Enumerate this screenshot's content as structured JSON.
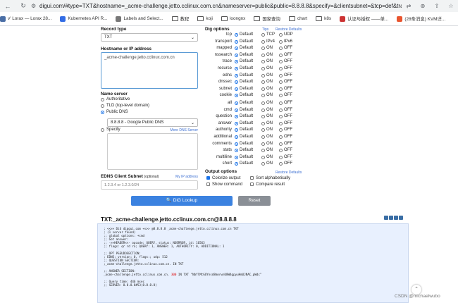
{
  "browser": {
    "url": "digui.com/#type=TXT&hostname=_acme-challenge.jetto.cclinux.com.cn&nameserver=public&public=8.8.8.8&specify=&clientsubnet=&tcp=def&transpor...",
    "bookmarks": [
      {
        "label": "v' Lorax — Lorax 28...",
        "icon": "lorax-icon",
        "color": "#4a6ea5"
      },
      {
        "label": "Kubernetes API R...",
        "icon": "kubernetes-icon",
        "color": "#326ce5"
      },
      {
        "label": "Labels and Select...",
        "icon": "globe-icon",
        "color": "#777"
      },
      {
        "label": "教程",
        "icon": "folder-icon",
        "color": ""
      },
      {
        "label": "koji",
        "icon": "folder-icon",
        "color": ""
      },
      {
        "label": "loongnx",
        "icon": "folder-icon",
        "color": ""
      },
      {
        "label": "国家查询",
        "icon": "folder-icon",
        "color": ""
      },
      {
        "label": "chart",
        "icon": "folder-icon",
        "color": ""
      },
      {
        "label": "k8s",
        "icon": "folder-icon",
        "color": ""
      },
      {
        "label": "认证与授权 ——单...",
        "icon": "globe-icon",
        "color": "#c33"
      },
      {
        "label": "(28条消息) KVM详...",
        "icon": "csdn-icon",
        "color": "#e9552f"
      }
    ]
  },
  "form": {
    "record_type_label": "Record type",
    "record_type_value": "TXT",
    "hostname_label": "Hostname or IP address",
    "hostname_value": "_acme-challenge.jetto.cclinux.com.cn",
    "nameserver_label": "Name server",
    "ns_options": [
      {
        "label": "Authoritative",
        "checked": false
      },
      {
        "label": "TLD (top-level domain)",
        "checked": false
      },
      {
        "label": "Public DNS",
        "checked": true
      }
    ],
    "public_dns_value": "8.8.8.8 - Google Public DNS",
    "specify_label": "Specify",
    "more_dns_link": "More DNS Server",
    "edns_label": "EDNS Client Subnet",
    "edns_optional": "(optional)",
    "my_ip_link": "My IP address",
    "edns_placeholder": "1.2.3.4 or 1.2.3.0/24"
  },
  "dig_options": {
    "title": "Dig options",
    "tips_link": "Tips",
    "restore_link": "Restore Defaults",
    "rows1": [
      {
        "label": "tcp",
        "c2": "TCP",
        "c3": "UDP"
      },
      {
        "label": "transport",
        "c2": "IPv4",
        "c3": "IPv6"
      },
      {
        "label": "mapped",
        "c2": "ON",
        "c3": "OFF"
      },
      {
        "label": "nssearch",
        "c2": "ON",
        "c3": "OFF"
      },
      {
        "label": "trace",
        "c2": "ON",
        "c3": "OFF"
      },
      {
        "label": "recurse",
        "c2": "ON",
        "c3": "OFF"
      },
      {
        "label": "edns",
        "c2": "ON",
        "c3": "OFF"
      },
      {
        "label": "dnssec",
        "c2": "ON",
        "c3": "OFF"
      },
      {
        "label": "subnet",
        "c2": "ON",
        "c3": "OFF"
      },
      {
        "label": "cookie",
        "c2": "ON",
        "c3": "OFF"
      }
    ],
    "rows2": [
      {
        "label": "all",
        "c2": "ON",
        "c3": "OFF"
      },
      {
        "label": "cmd",
        "c2": "ON",
        "c3": "OFF"
      },
      {
        "label": "question",
        "c2": "ON",
        "c3": "OFF"
      },
      {
        "label": "answer",
        "c2": "ON",
        "c3": "OFF"
      },
      {
        "label": "authority",
        "c2": "ON",
        "c3": "OFF"
      },
      {
        "label": "additional",
        "c2": "ON",
        "c3": "OFF"
      },
      {
        "label": "comments",
        "c2": "ON",
        "c3": "OFF"
      },
      {
        "label": "stats",
        "c2": "ON",
        "c3": "OFF"
      },
      {
        "label": "multiline",
        "c2": "ON",
        "c3": "OFF"
      },
      {
        "label": "short",
        "c2": "ON",
        "c3": "OFF"
      }
    ],
    "default_label": "Default"
  },
  "output_options": {
    "title": "Output options",
    "restore_link": "Restore Defaults",
    "colorize": "Colorize output",
    "sort": "Sort alphabetically",
    "show_command": "Show command",
    "compare": "Compare result"
  },
  "buttons": {
    "dig_lookup": "DiG Lookup",
    "reset": "Reset"
  },
  "result": {
    "title": "TXT:_acme-challenge.jetto.cclinux.com.cn@8.8.8.8",
    "lines": [
      "; <<>> DiG diggui.com <<>> @8.8.8.8 _acme-challenge.jetto.cclinux.com.cn TXT",
      "; (1 server found)",
      ";; global options: +cmd",
      ";; Got answer:",
      ";; ->>HEADER<<- opcode: QUERY, status: NOERROR, id: 16563",
      ";; flags: qr rd ra; QUERY: 1, ANSWER: 1, AUTHORITY: 0, ADDITIONAL: 1",
      "",
      ";; OPT PSEUDOSECTION:",
      "; EDNS: version: 0, flags:; udp: 512",
      ";; QUESTION SECTION:",
      ";_acme-challenge.jetto.cclinux.com.cn. IN TXT",
      "",
      ";; ANSWER SECTION:",
      "",
      "",
      ";; Query time: 446 msec",
      ";; SERVER: 8.8.8.8#53(8.8.8.8)"
    ],
    "answer_prefix": "_acme-challenge.jetto.cclinux.com.cn. ",
    "answer_ttl": "300",
    "answer_rest": " IN TXT \"NbYlMtGOYnsd8mnrwnU8W4gpyuHmUJNAC_pWdc\""
  },
  "watermark": "CSDN @michaelwubo"
}
